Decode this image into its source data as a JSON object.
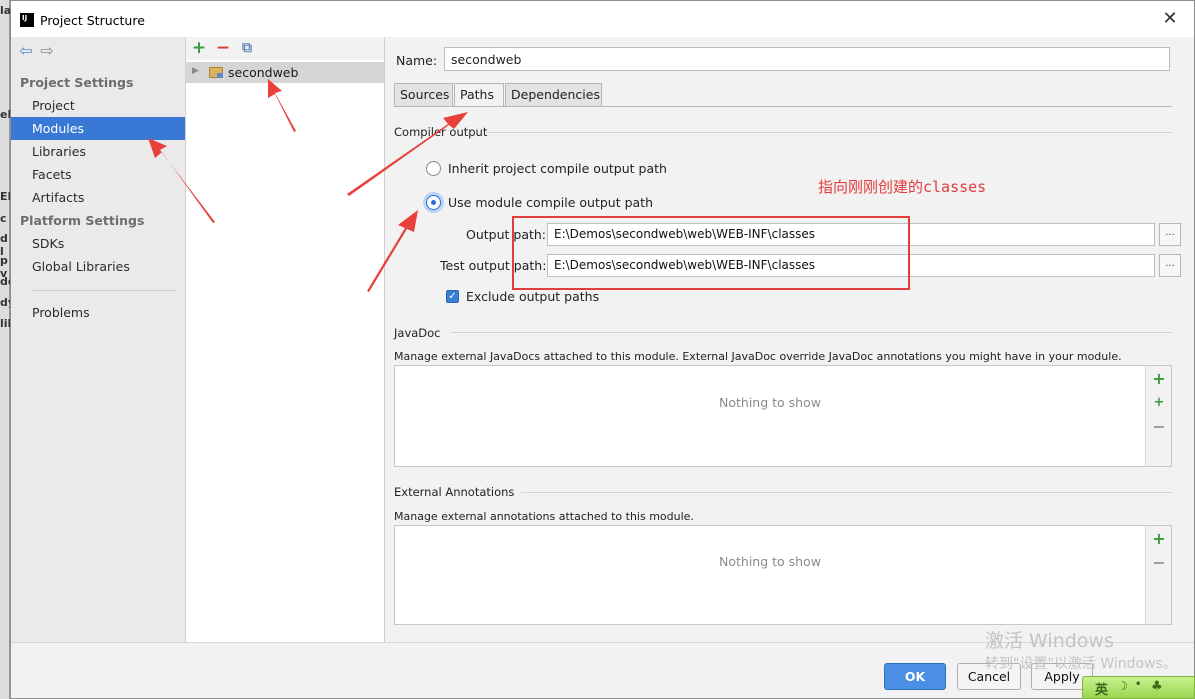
{
  "dialog": {
    "title": "Project Structure"
  },
  "behind_window": {
    "fragments": [
      "la",
      "eb",
      "c",
      "EE",
      "d l",
      "p v",
      "de",
      "dy",
      "lib"
    ]
  },
  "nav": {
    "section_project": "Project Settings",
    "project_items": [
      "Project",
      "Modules",
      "Libraries",
      "Facets",
      "Artifacts"
    ],
    "section_platform": "Platform Settings",
    "platform_items": [
      "SDKs",
      "Global Libraries"
    ],
    "problems": "Problems",
    "selected": "Modules"
  },
  "module_tree": {
    "items": [
      "secondweb"
    ]
  },
  "details": {
    "name_label": "Name:",
    "name_value": "secondweb",
    "tabs": [
      "Sources",
      "Paths",
      "Dependencies"
    ],
    "active_tab": "Paths",
    "compiler_output_title": "Compiler output",
    "radio_inherit": "Inherit project compile output path",
    "radio_module": "Use module compile output path",
    "selected_radio": "module",
    "output_path_label": "Output path:",
    "output_path_value": "E:\\Demos\\secondweb\\web\\WEB-INF\\classes",
    "test_output_path_label": "Test output path:",
    "test_output_path_value": "E:\\Demos\\secondweb\\web\\WEB-INF\\classes",
    "browse_label": "...",
    "exclude_label": "Exclude output paths",
    "exclude_checked": true,
    "javadoc_title": "JavaDoc",
    "javadoc_desc": "Manage external JavaDocs attached to this module. External JavaDoc override JavaDoc annotations you might have in your module.",
    "javadoc_empty": "Nothing to show",
    "ext_ann_title": "External Annotations",
    "ext_ann_desc": "Manage external annotations attached to this module.",
    "ext_ann_empty": "Nothing to show"
  },
  "footer": {
    "ok": "OK",
    "cancel": "Cancel",
    "apply": "Apply"
  },
  "annotation": {
    "text": "指向刚刚创建的classes",
    "color": "#e23c3c"
  },
  "watermark": {
    "line1": "激活 Windows",
    "line2": "转到\"设置\"以激活 Windows。"
  },
  "ime": {
    "label": "英"
  },
  "colors": {
    "selection": "#3a78d6",
    "primary_button": "#4a8fe3",
    "annotation": "#e23c3c"
  }
}
